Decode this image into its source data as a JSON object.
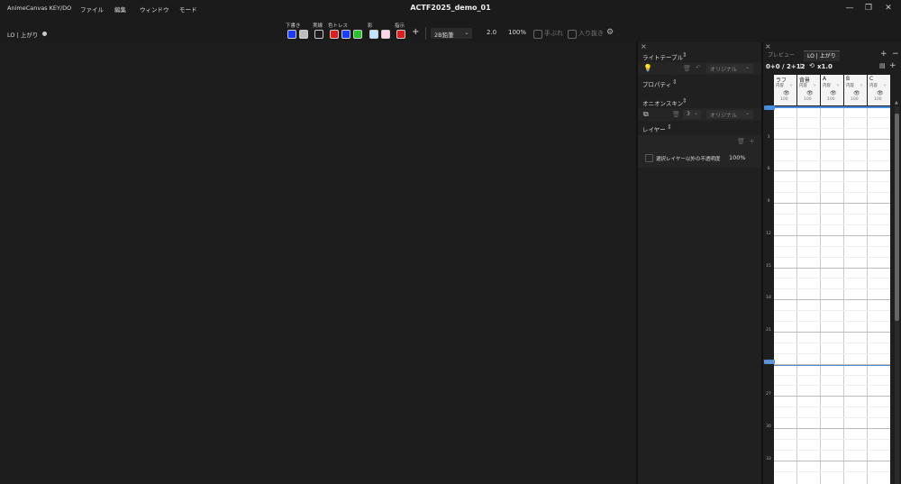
{
  "app": {
    "name": "AnimeCanvas KEY/DO",
    "window_title": "ACTF2025_demo_01",
    "menus": [
      "ファイル",
      "編集",
      "ウィンドウ",
      "モード"
    ]
  },
  "toolbar": {
    "document_label": "LO | 上がり",
    "swatch_groups": [
      "下書き",
      "実線",
      "色トレス",
      "影",
      "指示"
    ],
    "swatches": [
      "#1a3cff",
      "#bdbdbd",
      "#1b1b1b",
      "#e21c1c",
      "#1a3cff",
      "#24c424",
      "#bfe4ff",
      "#ffd6ea",
      "#e21c1c"
    ],
    "brush": "2B鉛筆",
    "size": "2.0",
    "opacity": "100%",
    "stabilizer_label": "手ぶれ",
    "pressure_label": "入り抜き"
  },
  "panels": {
    "light_table": {
      "title": "ライトテーブル",
      "mode": "オリジナル"
    },
    "property": {
      "title": "プロパティ"
    },
    "onion_skin": {
      "title": "オニオンスキン",
      "count": "3",
      "mode": "オリジナル"
    },
    "layer": {
      "title": "レイヤー",
      "lock_label": "選択レイヤー以外の不透明度",
      "opacity": "100%"
    }
  },
  "timeline": {
    "tabs": [
      "プレビュー",
      "LO | 上がり"
    ],
    "counter": "0+0 / 2+12",
    "speed": "x1.0",
    "columns": [
      {
        "name": "ラフ",
        "sub": "内容",
        "value": "100"
      },
      {
        "name": "背景",
        "sub": "内容",
        "value": "100"
      },
      {
        "name": "A",
        "sub": "内容",
        "value": "100"
      },
      {
        "name": "B",
        "sub": "内容",
        "value": "100"
      },
      {
        "name": "C",
        "sub": "内容",
        "value": "100"
      }
    ],
    "row_labels": [
      "3",
      "6",
      "9",
      "12",
      "15",
      "18",
      "21",
      "1+24",
      "27",
      "30",
      "33"
    ]
  }
}
